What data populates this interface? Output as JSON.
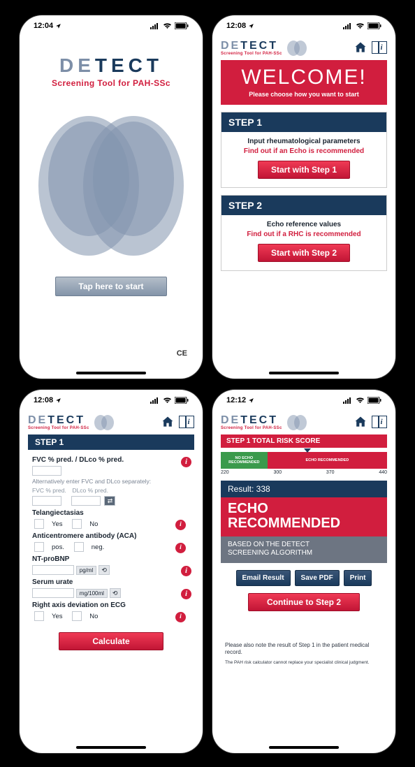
{
  "app": {
    "logo_prefix": "DE",
    "logo_suffix": "TECT",
    "tagline": "Screening Tool for PAH-SSc"
  },
  "screen1": {
    "time": "12:04",
    "start_button": "Tap here to start",
    "ce_mark": "CE"
  },
  "screen2": {
    "time": "12:08",
    "welcome_title": "WELCOME!",
    "welcome_sub": "Please choose how you want to start",
    "steps": [
      {
        "head": "STEP 1",
        "line1": "Input rheumatological parameters",
        "line2": "Find out if an Echo is recommended",
        "button": "Start with Step 1"
      },
      {
        "head": "STEP 2",
        "line1": "Echo reference values",
        "line2": "Find out if a RHC is recommended",
        "button": "Start with Step 2"
      }
    ]
  },
  "screen3": {
    "time": "12:08",
    "step_head": "STEP 1",
    "f1_label": "FVC % pred. / DLco % pred.",
    "f1_alt": "Alternatively enter FVC and DLco separately:",
    "f1_fvc": "FVC % pred.",
    "f1_dlco": "DLco % pred.",
    "f2_label": "Telangiectasias",
    "yes": "Yes",
    "no": "No",
    "f3_label": "Anticentromere antibody (ACA)",
    "pos": "pos.",
    "neg": "neg.",
    "f4_label": "NT-proBNP",
    "f4_unit": "pg/ml",
    "f5_label": "Serum urate",
    "f5_unit": "mg/100ml",
    "f6_label": "Right axis deviation on ECG",
    "calculate": "Calculate"
  },
  "screen4": {
    "time": "12:12",
    "score_head": "STEP 1 TOTAL RISK SCORE",
    "scale_green": "NO ECHO RECOMMENDED",
    "scale_red": "ECHO RECOMMENDED",
    "ticks": [
      "220",
      "300",
      "370",
      "440"
    ],
    "result_line": "Result: 338",
    "result_big1": "ECHO",
    "result_big2": "RECOMMENDED",
    "result_sub1": "BASED ON THE DETECT",
    "result_sub2": "SCREENING ALGORITHM",
    "buttons": [
      "Email Result",
      "Save PDF",
      "Print"
    ],
    "continue": "Continue to Step 2",
    "note": "Please also note the result of Step 1 in the patient medical record.",
    "note2": "The PAH risk calculator cannot replace your specialist clinical judgment."
  }
}
